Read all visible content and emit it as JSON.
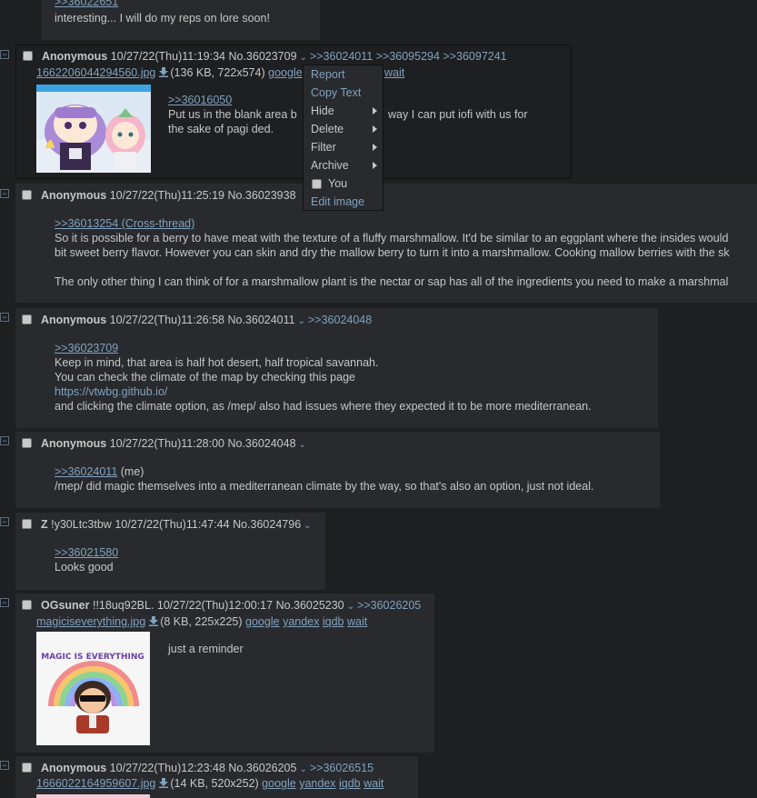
{
  "prev_post": {
    "quote": ">>36022651",
    "text": "interesting... I will do my reps on lore soon!"
  },
  "post1": {
    "name": "Anonymous",
    "date": "10/27/22(Thu)11:19:34",
    "num": "No.36023709",
    "backlinks": [
      ">>36024011",
      ">>36095294",
      ">>36097241"
    ],
    "file": "1662206044294560.jpg",
    "fileinfo": "(136 KB, 722x574)",
    "search": [
      "google",
      "wait"
    ],
    "quote": ">>36016050",
    "text1": "Put us in the blank area b",
    "text1b": "way I can put iofi with us for",
    "text2": "the sake of pagi ded."
  },
  "menu": {
    "report": "Report",
    "copy": "Copy Text",
    "hide": "Hide",
    "delete": "Delete",
    "filter": "Filter",
    "archive": "Archive",
    "you": "You",
    "edit": "Edit image"
  },
  "post2": {
    "name": "Anonymous",
    "date": "10/27/22(Thu)11:25:19",
    "num": "No.36023938",
    "quote": ">>36013254 (Cross-thread)",
    "text1": "So it is possible for a berry to have meat with the texture of a fluffy marshmallow. It'd be similar to an eggplant where the insides would",
    "text2": "bit sweet berry flavor. However you can skin and dry the mallow berry to turn it into a marshmallow. Cooking mallow berries with the sk",
    "text3": "The only other thing I can think of for a marshmallow plant is the nectar or sap has all of the ingredients you need to make a marshmal"
  },
  "post3": {
    "name": "Anonymous",
    "date": "10/27/22(Thu)11:26:58",
    "num": "No.36024011",
    "backlink": ">>36024048",
    "quote": ">>36023709",
    "text1": "Keep in mind, that area is half hot desert, half tropical savannah.",
    "text2": "You can check the climate of the map by checking this page",
    "url": "https://vtwbg.github.io/",
    "text3": "and clicking the climate option, as /mep/ also had issues where they expected it to be more mediterranean."
  },
  "post4": {
    "name": "Anonymous",
    "date": "10/27/22(Thu)11:28:00",
    "num": "No.36024048",
    "quote": ">>36024011",
    "me": " (me)",
    "text1": "/mep/ did magic themselves into a mediterranean climate by the way, so that's also an option, just not ideal."
  },
  "post5": {
    "name": "Z",
    "trip": "!y30Ltc3tbw",
    "date": "10/27/22(Thu)11:47:44",
    "num": "No.36024796",
    "quote": ">>36021580",
    "text1": "Looks good"
  },
  "post6": {
    "name": "OGsuner",
    "trip": "!!18uq92BL.",
    "date": "10/27/22(Thu)12:00:17",
    "num": "No.36025230",
    "backlink": ">>36026205",
    "file": "magiciseverything.jpg",
    "fileinfo": "(8 KB, 225x225)",
    "search": [
      "google",
      "yandex",
      "iqdb",
      "wait"
    ],
    "text1": "just a reminder",
    "sticker_text": "MAGIC IS EVERYTHING"
  },
  "post7": {
    "name": "Anonymous",
    "date": "10/27/22(Thu)12:23:48",
    "num": "No.36026205",
    "backlink": ">>36026515",
    "file": "1666022164959607.jpg",
    "fileinfo": "(14 KB, 520x252)",
    "search": [
      "google",
      "yandex",
      "iqdb",
      "wait"
    ]
  },
  "colors": {
    "background": "#1d1f21",
    "post_bg": "#282a2e",
    "link": "#81a2be",
    "text": "#c5c8c6"
  }
}
